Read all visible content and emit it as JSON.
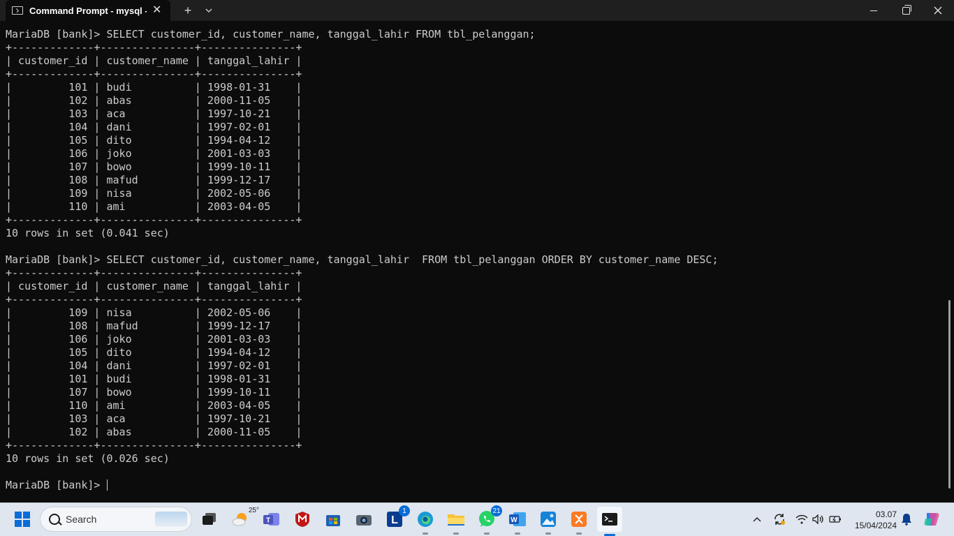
{
  "window": {
    "tab_title": "Command Prompt - mysql  -u",
    "tab_close": "✕",
    "new_tab": "+",
    "dropdown": "⌄"
  },
  "terminal": {
    "lines": [
      "MariaDB [bank]> SELECT customer_id, customer_name, tanggal_lahir FROM tbl_pelanggan;",
      "+-------------+---------------+---------------+",
      "| customer_id | customer_name | tanggal_lahir |",
      "+-------------+---------------+---------------+",
      "|         101 | budi          | 1998-01-31    |",
      "|         102 | abas          | 2000-11-05    |",
      "|         103 | aca           | 1997-10-21    |",
      "|         104 | dani          | 1997-02-01    |",
      "|         105 | dito          | 1994-04-12    |",
      "|         106 | joko          | 2001-03-03    |",
      "|         107 | bowo          | 1999-10-11    |",
      "|         108 | mafud         | 1999-12-17    |",
      "|         109 | nisa          | 2002-05-06    |",
      "|         110 | ami           | 2003-04-05    |",
      "+-------------+---------------+---------------+",
      "10 rows in set (0.041 sec)",
      "",
      "MariaDB [bank]> SELECT customer_id, customer_name, tanggal_lahir  FROM tbl_pelanggan ORDER BY customer_name DESC;",
      "+-------------+---------------+---------------+",
      "| customer_id | customer_name | tanggal_lahir |",
      "+-------------+---------------+---------------+",
      "|         109 | nisa          | 2002-05-06    |",
      "|         108 | mafud         | 1999-12-17    |",
      "|         106 | joko          | 2001-03-03    |",
      "|         105 | dito          | 1994-04-12    |",
      "|         104 | dani          | 1997-02-01    |",
      "|         101 | budi          | 1998-01-31    |",
      "|         107 | bowo          | 1999-10-11    |",
      "|         110 | ami           | 2003-04-05    |",
      "|         103 | aca           | 1997-10-21    |",
      "|         102 | abas          | 2000-11-05    |",
      "+-------------+---------------+---------------+",
      "10 rows in set (0.026 sec)",
      ""
    ],
    "prompt": "MariaDB [bank]> "
  },
  "taskbar": {
    "search_label": "Search",
    "weather_temp": "25°",
    "badges": {
      "l_app": "1",
      "whatsapp": "21"
    },
    "time": "03.07",
    "date": "15/04/2024"
  },
  "colors": {
    "terminal_bg": "#0c0c0c",
    "terminal_fg": "#cccccc",
    "taskbar_bg": "#dfe6ef",
    "accent": "#0a6cd8"
  }
}
